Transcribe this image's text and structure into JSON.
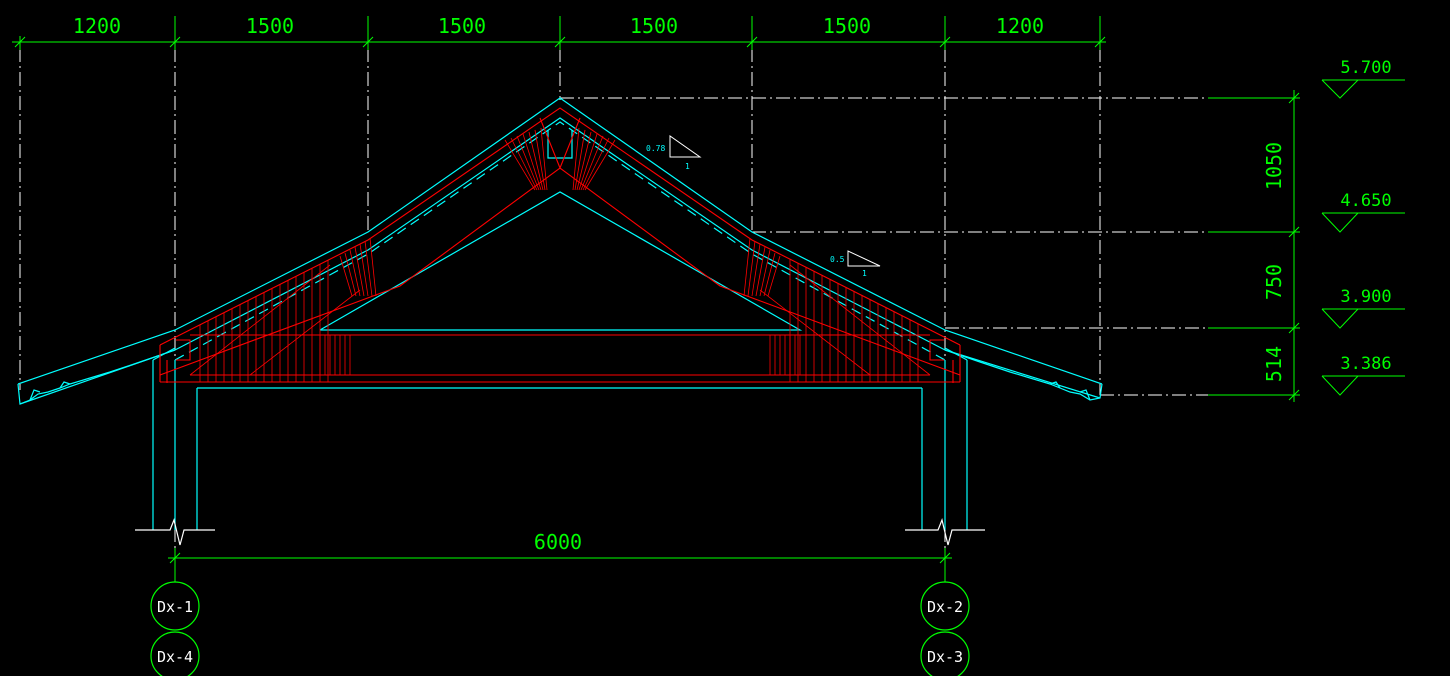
{
  "colors": {
    "background": "#000000",
    "dimension": "#00ff00",
    "outline": "#00ffff",
    "structure": "#ff0000",
    "axis": "#ffffff"
  },
  "top_dimensions": [
    "1200",
    "1500",
    "1500",
    "1500",
    "1500",
    "1200"
  ],
  "bottom_dimension": "6000",
  "height_dimensions": [
    "1050",
    "750",
    "514"
  ],
  "levels": [
    "5.700",
    "4.650",
    "3.900",
    "3.386"
  ],
  "slopes": [
    {
      "rise": "0.78",
      "run": "1"
    },
    {
      "rise": "0.5",
      "run": "1"
    }
  ],
  "grid_labels": {
    "left_top": "Dx-1",
    "left_bottom": "Dx-4",
    "right_top": "Dx-2",
    "right_bottom": "Dx-3"
  }
}
